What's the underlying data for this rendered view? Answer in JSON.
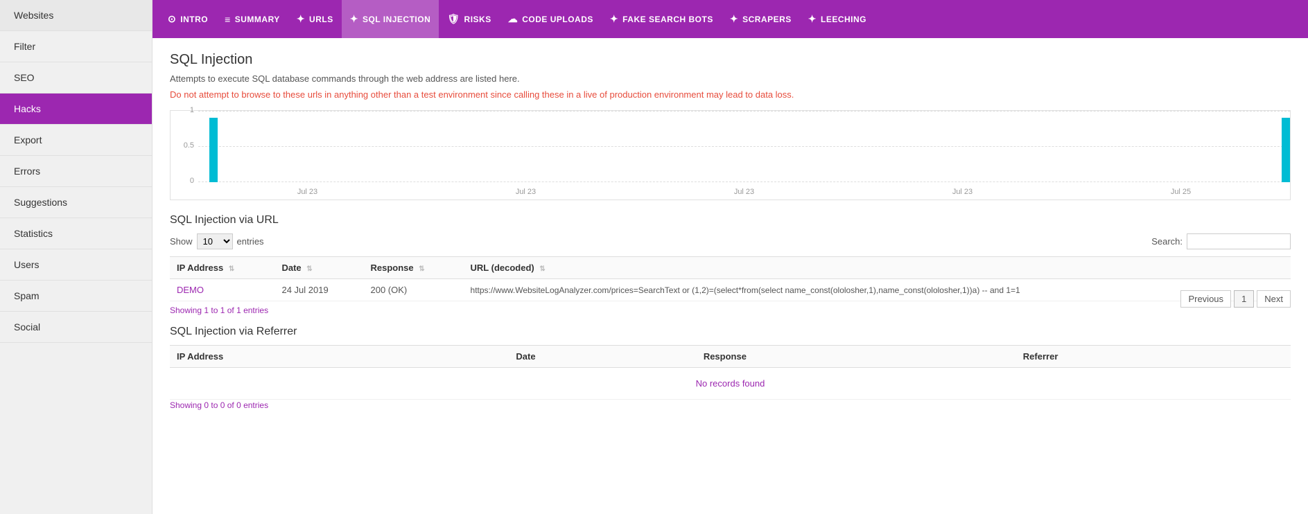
{
  "sidebar": {
    "items": [
      {
        "label": "Websites",
        "active": false
      },
      {
        "label": "Filter",
        "active": false
      },
      {
        "label": "SEO",
        "active": false
      },
      {
        "label": "Hacks",
        "active": true
      },
      {
        "label": "Export",
        "active": false
      },
      {
        "label": "Errors",
        "active": false
      },
      {
        "label": "Suggestions",
        "active": false
      },
      {
        "label": "Statistics",
        "active": false
      },
      {
        "label": "Users",
        "active": false
      },
      {
        "label": "Spam",
        "active": false
      },
      {
        "label": "Social",
        "active": false
      }
    ]
  },
  "topnav": {
    "items": [
      {
        "id": "intro",
        "label": "INTRO",
        "icon": "⊙",
        "active": false
      },
      {
        "id": "summary",
        "label": "SUMMARY",
        "icon": "≡",
        "active": false
      },
      {
        "id": "urls",
        "label": "URLS",
        "icon": "❖",
        "active": false
      },
      {
        "id": "sql-injection",
        "label": "SQL INJECTION",
        "icon": "❖",
        "active": true
      },
      {
        "id": "risks",
        "label": "RISKS",
        "icon": "🛡",
        "active": false
      },
      {
        "id": "code-uploads",
        "label": "CODE UPLOADS",
        "icon": "☁",
        "active": false
      },
      {
        "id": "fake-search-bots",
        "label": "FAKE SEARCH BOTS",
        "icon": "❖",
        "active": false
      },
      {
        "id": "scrapers",
        "label": "SCRAPERS",
        "icon": "❖",
        "active": false
      },
      {
        "id": "leeching",
        "label": "LEECHING",
        "icon": "❖",
        "active": false
      }
    ]
  },
  "page": {
    "title": "SQL Injection",
    "description": "Attempts to execute SQL database commands through the web address are listed here.",
    "warning": "Do not attempt to browse to these urls in anything other than a test environment since calling these in a live of production environment may lead to data loss."
  },
  "chart": {
    "y_labels": [
      "1",
      "0.5",
      "0"
    ],
    "x_labels": [
      "Jul 23",
      "Jul 23",
      "Jul 23",
      "Jul 23",
      "Jul 25"
    ]
  },
  "url_table": {
    "title": "SQL Injection via URL",
    "show_label": "Show",
    "entries_label": "entries",
    "search_label": "Search:",
    "show_value": "10",
    "columns": [
      "IP Address",
      "Date",
      "Response",
      "URL (decoded)"
    ],
    "rows": [
      {
        "ip": "DEMO",
        "date": "24 Jul 2019",
        "response": "200 (OK)",
        "url": "https://www.WebsiteLogAnalyzer.com/prices=SearchText or (1,2)=(select*from(select name_const(ololosher,1),name_const(ololosher,1))a) -- and 1=1"
      }
    ],
    "showing_text": "Showing 1 to 1 of 1 entries",
    "pagination": {
      "previous": "Previous",
      "page": "1",
      "next": "Next"
    }
  },
  "referrer_table": {
    "title": "SQL Injection via Referrer",
    "columns": [
      "IP Address",
      "Date",
      "Response",
      "Referrer"
    ],
    "no_records": "No records found",
    "showing_text": "Showing 0 to 0 of 0 entries"
  }
}
